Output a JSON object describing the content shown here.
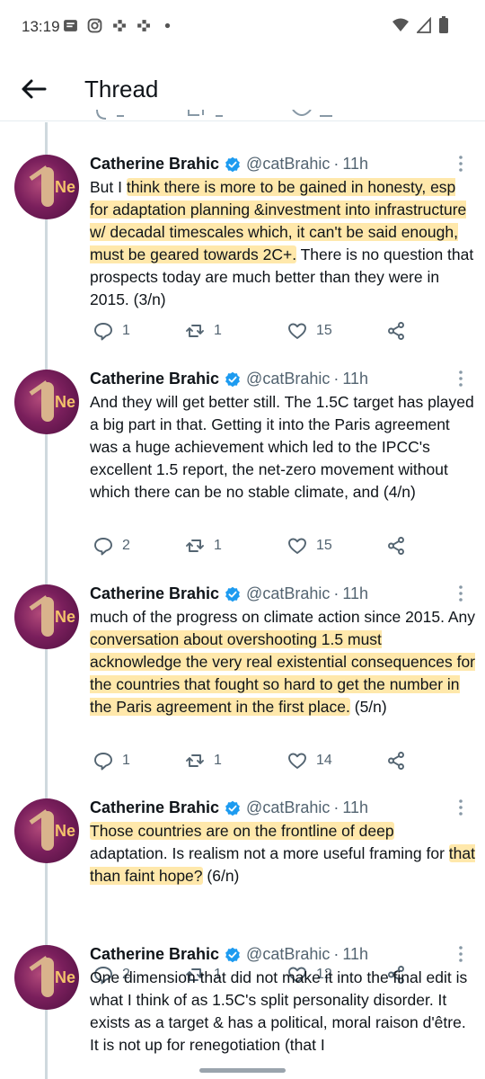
{
  "status_bar": {
    "time": "13:19",
    "icons": [
      "message-icon",
      "instagram-icon",
      "app-icon",
      "app-icon",
      "dot-icon",
      "wifi-icon",
      "signal-icon",
      "battery-icon"
    ]
  },
  "app_bar": {
    "title": "Thread"
  },
  "tweets": [
    {
      "name": "Catherine Brahic",
      "handle": "@catBrahic",
      "time": "11h",
      "text": "But I think there is more to be gained in honesty, esp for adaptation planning &investment into infrastructure w/ decadal timescales which, it can't be said enough, must be geared towards 2C+. There is no question that prospects today are much better than they were in 2015. (3/n)",
      "segments": [
        {
          "t": "But I ",
          "h": false
        },
        {
          "t": "think there is more to be gained in honesty, esp for adaptation planning &investment into infrastructure w/ decadal timescales which, it can't be said enough, must be geared towards 2C+.",
          "h": true
        },
        {
          "t": " There is no question that prospects today are much better than they were in 2015. (3/n)",
          "h": false
        }
      ],
      "replies": "1",
      "retweets": "1",
      "likes": "15"
    },
    {
      "name": "Catherine Brahic",
      "handle": "@catBrahic",
      "time": "11h",
      "text": "And they will get better still. The 1.5C target has played a big part in that. Getting it into the Paris agreement was a huge achievement which led to the IPCC's excellent 1.5 report, the net-zero movement without which there can be no stable climate, and (4/n)",
      "segments": [
        {
          "t": "And they will get better still. The 1.5C target has played a big part in that. Getting it into the Paris agreement was a huge achievement which led to the IPCC's excellent 1.5 report, the net-zero movement without which there can be no stable climate, and (4/n)",
          "h": false
        }
      ],
      "replies": "2",
      "retweets": "1",
      "likes": "15"
    },
    {
      "name": "Catherine Brahic",
      "handle": "@catBrahic",
      "time": "11h",
      "text": "much of the progress on climate action since 2015. Any conversation about overshooting 1.5 must acknowledge the very real existential consequences for the countries that fought so hard to get the number in the Paris agreement in the first place. (5/n)",
      "segments": [
        {
          "t": "much of the progress on climate action since 2015. Any ",
          "h": false
        },
        {
          "t": "conversation about overshooting 1.5 must acknowledge the very real existential consequences for the countries that fought so hard to get the number in the Paris agreement in the first place.",
          "h": true
        },
        {
          "t": " (5/n)",
          "h": false
        }
      ],
      "replies": "1",
      "retweets": "1",
      "likes": "14"
    },
    {
      "name": "Catherine Brahic",
      "handle": "@catBrahic",
      "time": "11h",
      "text": "Those countries are on the frontline of deep adaptation. Is realism not a more useful framing for that than faint hope? (6/n)",
      "segments": [
        {
          "t": "Those countries are on the frontline of deep",
          "h": true
        },
        {
          "t": " adaptation. Is realism not a more useful framing for ",
          "h": false
        },
        {
          "t": "that than faint hope?",
          "h": true
        },
        {
          "t": " (6/n)",
          "h": false
        }
      ],
      "replies": "2",
      "retweets": "1",
      "likes": "12"
    },
    {
      "name": "Catherine Brahic",
      "handle": "@catBrahic",
      "time": "11h",
      "text": "One dimension that did not make it into the final edit is what I think of as 1.5C's split personality disorder. It exists as a target & has a political, moral raison d'être. It is not up for renegotiation (that I",
      "segments": [
        {
          "t": "One dimension that did not make it into the final edit is what I think of as 1.5C's split personality disorder. It exists as a target & has a political, moral raison d'être. It is not up for renegotiation (that I",
          "h": false
        }
      ]
    }
  ]
}
